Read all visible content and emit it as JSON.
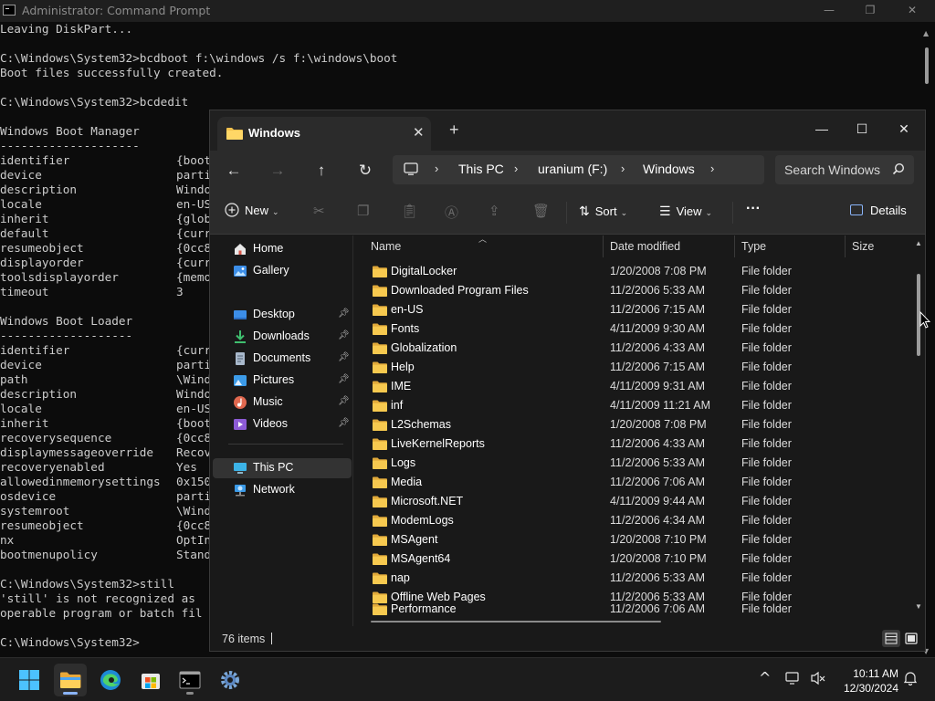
{
  "cmd": {
    "title": "Administrator: Command Prompt",
    "window_controls": {
      "minimize": "—",
      "maximize": "❐",
      "close": "✕"
    },
    "lines": [
      {
        "text": "Leaving DiskPart...",
        "value": ""
      },
      {
        "text": "",
        "value": ""
      },
      {
        "text": "C:\\Windows\\System32>bcdboot f:\\windows /s f:\\windows\\boot",
        "value": ""
      },
      {
        "text": "Boot files successfully created.",
        "value": ""
      },
      {
        "text": "",
        "value": ""
      },
      {
        "text": "C:\\Windows\\System32>bcdedit",
        "value": ""
      },
      {
        "text": "",
        "value": ""
      },
      {
        "text": "Windows Boot Manager",
        "value": ""
      },
      {
        "text": "--------------------",
        "value": ""
      },
      {
        "text": "identifier",
        "value": "{boot"
      },
      {
        "text": "device",
        "value": "parti"
      },
      {
        "text": "description",
        "value": "Windo"
      },
      {
        "text": "locale",
        "value": "en-US"
      },
      {
        "text": "inherit",
        "value": "{glob"
      },
      {
        "text": "default",
        "value": "{curr"
      },
      {
        "text": "resumeobject",
        "value": "{0cc8"
      },
      {
        "text": "displayorder",
        "value": "{curr"
      },
      {
        "text": "toolsdisplayorder",
        "value": "{memo"
      },
      {
        "text": "timeout",
        "value": "3"
      },
      {
        "text": "",
        "value": ""
      },
      {
        "text": "Windows Boot Loader",
        "value": ""
      },
      {
        "text": "-------------------",
        "value": ""
      },
      {
        "text": "identifier",
        "value": "{curr"
      },
      {
        "text": "device",
        "value": "parti"
      },
      {
        "text": "path",
        "value": "\\Wind"
      },
      {
        "text": "description",
        "value": "Windo"
      },
      {
        "text": "locale",
        "value": "en-US"
      },
      {
        "text": "inherit",
        "value": "{boot"
      },
      {
        "text": "recoverysequence",
        "value": "{0cc8"
      },
      {
        "text": "displaymessageoverride",
        "value": "Recov"
      },
      {
        "text": "recoveryenabled",
        "value": "Yes"
      },
      {
        "text": "allowedinmemorysettings",
        "value": "0x150"
      },
      {
        "text": "osdevice",
        "value": "parti"
      },
      {
        "text": "systemroot",
        "value": "\\Wind"
      },
      {
        "text": "resumeobject",
        "value": "{0cc8"
      },
      {
        "text": "nx",
        "value": "OptIn"
      },
      {
        "text": "bootmenupolicy",
        "value": "Stand"
      },
      {
        "text": "",
        "value": ""
      },
      {
        "text": "C:\\Windows\\System32>still",
        "value": ""
      },
      {
        "text": "'still' is not recognized as",
        "value": ""
      },
      {
        "text": "operable program or batch fil",
        "value": ""
      },
      {
        "text": "",
        "value": ""
      },
      {
        "text": "C:\\Windows\\System32>",
        "value": ""
      }
    ]
  },
  "explorer": {
    "tab_title": "Windows",
    "tab_close": "✕",
    "tab_add": "+",
    "window_controls": {
      "minimize": "—",
      "maximize": "☐",
      "close": "✕"
    },
    "nav": {
      "back": "←",
      "forward": "→",
      "up": "↑",
      "refresh": "↻"
    },
    "breadcrumb": [
      "This PC",
      "uranium (F:)",
      "Windows"
    ],
    "breadcrumb_sep": "›",
    "search_placeholder": "Search Windows",
    "toolbar": {
      "new_label": "New",
      "sort_label": "Sort",
      "view_label": "View",
      "more_label": "···",
      "details_label": "Details",
      "caret": "⌄"
    },
    "sidebar": {
      "home": "Home",
      "gallery": "Gallery",
      "pinned": [
        {
          "label": "Desktop",
          "icon": "desktop-icon"
        },
        {
          "label": "Downloads",
          "icon": "downloads-icon"
        },
        {
          "label": "Documents",
          "icon": "documents-icon"
        },
        {
          "label": "Pictures",
          "icon": "pictures-icon"
        },
        {
          "label": "Music",
          "icon": "music-icon"
        },
        {
          "label": "Videos",
          "icon": "videos-icon"
        }
      ],
      "this_pc": "This PC",
      "network": "Network"
    },
    "columns": {
      "name": "Name",
      "date": "Date modified",
      "type": "Type",
      "size": "Size"
    },
    "files": [
      {
        "name": "DigitalLocker",
        "date": "1/20/2008 7:08 PM",
        "type": "File folder"
      },
      {
        "name": "Downloaded Program Files",
        "date": "11/2/2006 5:33 AM",
        "type": "File folder"
      },
      {
        "name": "en-US",
        "date": "11/2/2006 7:15 AM",
        "type": "File folder"
      },
      {
        "name": "Fonts",
        "date": "4/11/2009 9:30 AM",
        "type": "File folder"
      },
      {
        "name": "Globalization",
        "date": "11/2/2006 4:33 AM",
        "type": "File folder"
      },
      {
        "name": "Help",
        "date": "11/2/2006 7:15 AM",
        "type": "File folder"
      },
      {
        "name": "IME",
        "date": "4/11/2009 9:31 AM",
        "type": "File folder"
      },
      {
        "name": "inf",
        "date": "4/11/2009 11:21 AM",
        "type": "File folder"
      },
      {
        "name": "L2Schemas",
        "date": "1/20/2008 7:08 PM",
        "type": "File folder"
      },
      {
        "name": "LiveKernelReports",
        "date": "11/2/2006 4:33 AM",
        "type": "File folder"
      },
      {
        "name": "Logs",
        "date": "11/2/2006 5:33 AM",
        "type": "File folder"
      },
      {
        "name": "Media",
        "date": "11/2/2006 7:06 AM",
        "type": "File folder"
      },
      {
        "name": "Microsoft.NET",
        "date": "4/11/2009 9:44 AM",
        "type": "File folder"
      },
      {
        "name": "ModemLogs",
        "date": "11/2/2006 4:34 AM",
        "type": "File folder"
      },
      {
        "name": "MSAgent",
        "date": "1/20/2008 7:10 PM",
        "type": "File folder"
      },
      {
        "name": "MSAgent64",
        "date": "1/20/2008 7:10 PM",
        "type": "File folder"
      },
      {
        "name": "nap",
        "date": "11/2/2006 5:33 AM",
        "type": "File folder"
      },
      {
        "name": "Offline Web Pages",
        "date": "11/2/2006 5:33 AM",
        "type": "File folder"
      },
      {
        "name": "Performance",
        "date": "11/2/2006 7:06 AM",
        "type": "File folder"
      }
    ],
    "status_count": "76 items"
  },
  "taskbar": {
    "clock_time": "10:11 AM",
    "clock_date": "12/30/2024",
    "tray_chevron": "^"
  },
  "colors": {
    "cmd_bg": "#0c0c0c",
    "explorer_bg": "#191919",
    "folder_yellow": "#f2c14e",
    "accent_blue": "#3c8ee8"
  }
}
